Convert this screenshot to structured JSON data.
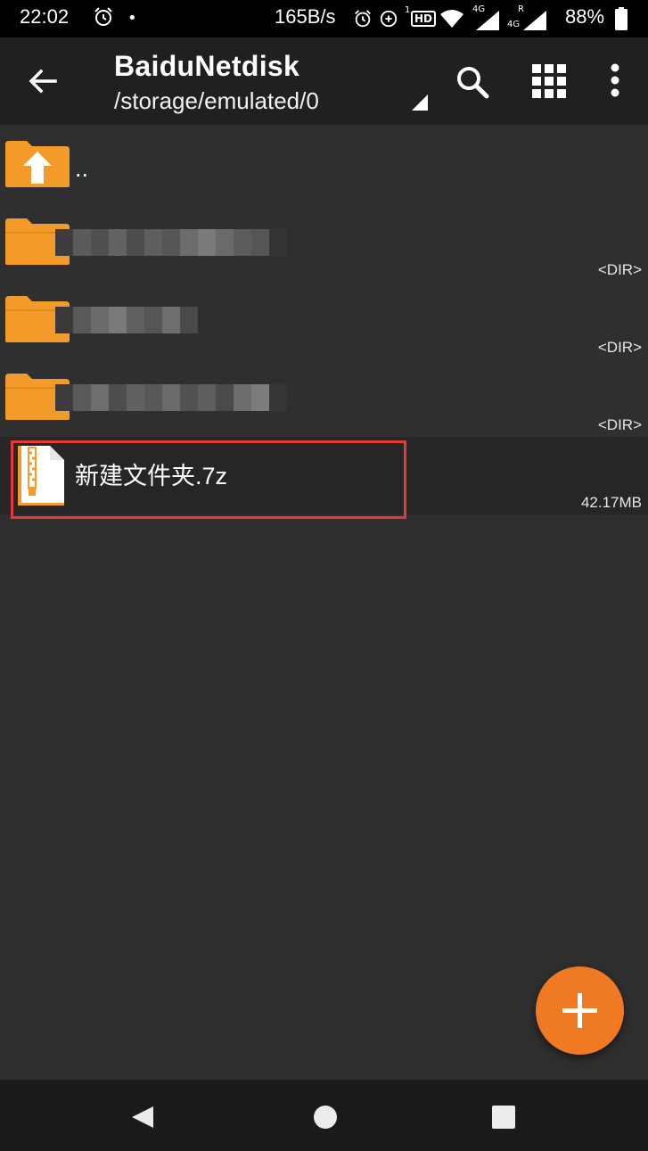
{
  "status_bar": {
    "time": "22:02",
    "dot": "•",
    "net_speed": "165B/s",
    "sim1_label": "1",
    "hd_label": "HD",
    "net1_label": "4G",
    "roaming_label": "R",
    "net2_label": "4G",
    "battery": "88%"
  },
  "appbar": {
    "title": "BaiduNetdisk",
    "path": "/storage/emulated/0"
  },
  "files": [
    {
      "name": "..",
      "meta": "",
      "type": "parent"
    },
    {
      "name": "",
      "meta": "<DIR>",
      "type": "folder"
    },
    {
      "name": "",
      "meta": "<DIR>",
      "type": "folder"
    },
    {
      "name": "",
      "meta": "<DIR>",
      "type": "folder"
    },
    {
      "name": "新建文件夹.7z",
      "meta": "42.17MB",
      "type": "archive"
    }
  ],
  "colors": {
    "accent": "#ef7a23",
    "folder": "#f49a2a",
    "highlight": "#e53935"
  },
  "icons": [
    "back-arrow-icon",
    "search-icon",
    "grid-view-icon",
    "more-vert-icon",
    "add-icon",
    "folder-icon",
    "zip-file-icon"
  ]
}
